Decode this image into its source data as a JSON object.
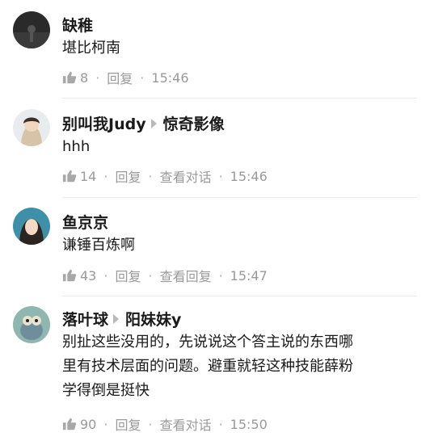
{
  "comments": [
    {
      "author": "缺稚",
      "reply_to": "",
      "text": "堪比柯南",
      "likes": "8",
      "actions": [
        "回复"
      ],
      "time": "15:46"
    },
    {
      "author": "别叫我Judy",
      "reply_to": "惊奇影像",
      "text": "hhh",
      "likes": "14",
      "actions": [
        "回复",
        "查看对话"
      ],
      "time": "15:46"
    },
    {
      "author": "鱼京京",
      "reply_to": "",
      "text": "谦锤百炼啊",
      "likes": "43",
      "actions": [
        "回复",
        "查看回复"
      ],
      "time": "15:47"
    },
    {
      "author": "落叶球",
      "reply_to": "阳妹妹y",
      "text_lines": [
        "别扯这些没用的，先说说这个答主说的东西哪",
        "里有技术层面的问题。避重就轻这种技能薛粉",
        "学得倒是挺快"
      ],
      "likes": "90",
      "actions": [
        "回复",
        "查看对话"
      ],
      "time": "15:50"
    }
  ],
  "icons": {
    "like": "thumbs-up-icon",
    "separator": "dot"
  },
  "colors": {
    "meta": "#9a9a9a",
    "author": "#1a1a1a",
    "arrow": "#b8b8b8"
  }
}
